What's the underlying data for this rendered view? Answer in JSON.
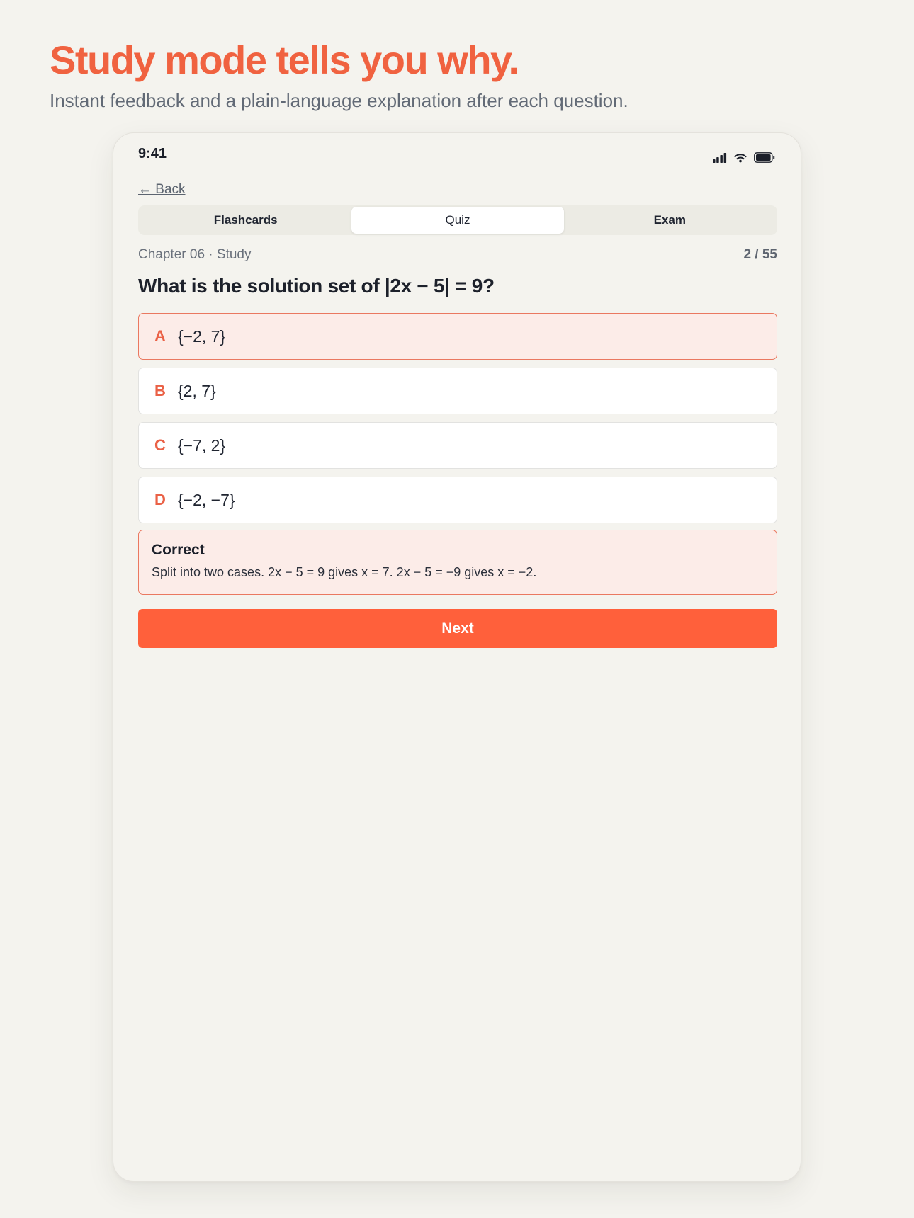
{
  "hero": {
    "title": "Study mode tells you why.",
    "subtitle": "Instant feedback and a plain-language explanation after each question."
  },
  "status_bar": {
    "time": "9:41",
    "icons": [
      "cellular-signal-icon",
      "wifi-icon",
      "battery-icon"
    ]
  },
  "nav": {
    "back_label": "← Back"
  },
  "tabs": [
    {
      "label": "Flashcards",
      "active": false
    },
    {
      "label": "Quiz",
      "active": true
    },
    {
      "label": "Exam",
      "active": false
    }
  ],
  "meta": {
    "chapter": "Chapter 06 · Study",
    "progress": "2 / 55"
  },
  "question": {
    "text": "What is the solution set of |2x − 5| = 9?",
    "options": [
      {
        "letter": "A",
        "text": "{−2, 7}",
        "selected": true
      },
      {
        "letter": "B",
        "text": "{2, 7}",
        "selected": false
      },
      {
        "letter": "C",
        "text": "{−7, 2}",
        "selected": false
      },
      {
        "letter": "D",
        "text": "{−2, −7}",
        "selected": false
      }
    ]
  },
  "feedback": {
    "title": "Correct",
    "text": "Split into two cases. 2x − 5 = 9 gives x = 7. 2x − 5 = −9 gives x = −2."
  },
  "actions": {
    "next_label": "Next"
  },
  "colors": {
    "accent": "#ff603b",
    "heading_accent": "#f06240",
    "selected_bg": "#fcece8",
    "selected_border": "#ea7860",
    "background": "#f4f3ee"
  }
}
